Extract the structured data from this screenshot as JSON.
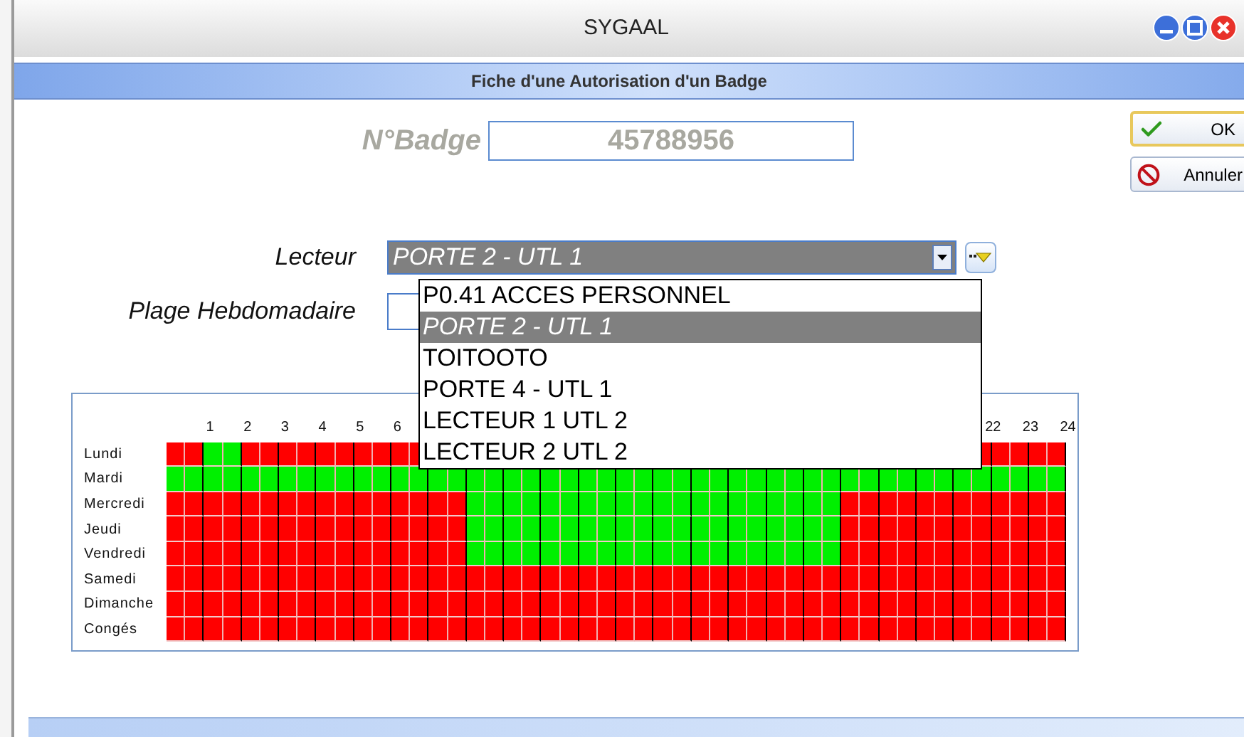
{
  "window": {
    "title": "SYGAAL"
  },
  "header": {
    "title": "Fiche d'une Autorisation d'un Badge"
  },
  "badge": {
    "label": "N°Badge",
    "value": "45788956"
  },
  "buttons": [
    {
      "kind": "ok",
      "label": "OK"
    },
    {
      "kind": "cancel",
      "label": "Annuler"
    }
  ],
  "lecteur": {
    "label": "Lecteur",
    "value": "PORTE 2 - UTL 1",
    "expanded": true,
    "options": [
      {
        "label": "P0.41 ACCES PERSONNEL",
        "selected": false
      },
      {
        "label": "PORTE 2 - UTL 1",
        "selected": true
      },
      {
        "label": "TOITOOTO",
        "selected": false
      },
      {
        "label": "PORTE 4 - UTL 1",
        "selected": false
      },
      {
        "label": "LECTEUR 1 UTL 2",
        "selected": false
      },
      {
        "label": "LECTEUR 2 UTL 2",
        "selected": false
      }
    ]
  },
  "plage": {
    "label": "Plage Hebdomadaire"
  },
  "hour_labels_start": [
    "1",
    "2",
    "3",
    "4",
    "5",
    "6"
  ],
  "hour_labels_end": [
    "22",
    "23",
    "24"
  ],
  "days": [
    {
      "label": "Lundi",
      "slots_start": [
        false,
        false,
        true,
        true,
        false,
        false,
        false,
        false,
        false,
        false,
        false,
        false,
        false,
        false
      ],
      "slots_end": [
        false,
        false,
        false,
        false,
        false
      ]
    },
    {
      "label": "Mardi",
      "slots": [
        true,
        true,
        true,
        true,
        true,
        true,
        true,
        true,
        true,
        true,
        true,
        true,
        true,
        true,
        true,
        true,
        true,
        true,
        true,
        true,
        true,
        true,
        true,
        true,
        true,
        true,
        true,
        true,
        true,
        true,
        true,
        true,
        true,
        true,
        true,
        true,
        true,
        true,
        true,
        true,
        true,
        true,
        true,
        true,
        true,
        true,
        true,
        true
      ]
    },
    {
      "label": "Mercredi",
      "slots": [
        false,
        false,
        false,
        false,
        false,
        false,
        false,
        false,
        false,
        false,
        false,
        false,
        false,
        false,
        false,
        false,
        true,
        true,
        true,
        true,
        true,
        true,
        true,
        true,
        true,
        true,
        true,
        true,
        true,
        true,
        true,
        true,
        true,
        true,
        true,
        true,
        false,
        false,
        false,
        false,
        false,
        false,
        false,
        false,
        false,
        false,
        false,
        false
      ]
    },
    {
      "label": "Jeudi",
      "slots": [
        false,
        false,
        false,
        false,
        false,
        false,
        false,
        false,
        false,
        false,
        false,
        false,
        false,
        false,
        false,
        false,
        true,
        true,
        true,
        true,
        true,
        true,
        true,
        true,
        true,
        true,
        true,
        true,
        true,
        true,
        true,
        true,
        true,
        true,
        true,
        true,
        false,
        false,
        false,
        false,
        false,
        false,
        false,
        false,
        false,
        false,
        false,
        false
      ]
    },
    {
      "label": "Vendredi",
      "slots": [
        false,
        false,
        false,
        false,
        false,
        false,
        false,
        false,
        false,
        false,
        false,
        false,
        false,
        false,
        false,
        false,
        true,
        true,
        true,
        true,
        true,
        true,
        true,
        true,
        true,
        true,
        true,
        true,
        true,
        true,
        true,
        true,
        true,
        true,
        true,
        true,
        false,
        false,
        false,
        false,
        false,
        false,
        false,
        false,
        false,
        false,
        false,
        false
      ]
    },
    {
      "label": "Samedi",
      "slots": [
        false,
        false,
        false,
        false,
        false,
        false,
        false,
        false,
        false,
        false,
        false,
        false,
        false,
        false,
        false,
        false,
        false,
        false,
        false,
        false,
        false,
        false,
        false,
        false,
        false,
        false,
        false,
        false,
        false,
        false,
        false,
        false,
        false,
        false,
        false,
        false,
        false,
        false,
        false,
        false,
        false,
        false,
        false,
        false,
        false,
        false,
        false,
        false
      ]
    },
    {
      "label": "Dimanche",
      "slots": [
        false,
        false,
        false,
        false,
        false,
        false,
        false,
        false,
        false,
        false,
        false,
        false,
        false,
        false,
        false,
        false,
        false,
        false,
        false,
        false,
        false,
        false,
        false,
        false,
        false,
        false,
        false,
        false,
        false,
        false,
        false,
        false,
        false,
        false,
        false,
        false,
        false,
        false,
        false,
        false,
        false,
        false,
        false,
        false,
        false,
        false,
        false,
        false
      ]
    },
    {
      "label": "Congés",
      "slots": [
        false,
        false,
        false,
        false,
        false,
        false,
        false,
        false,
        false,
        false,
        false,
        false,
        false,
        false,
        false,
        false,
        false,
        false,
        false,
        false,
        false,
        false,
        false,
        false,
        false,
        false,
        false,
        false,
        false,
        false,
        false,
        false,
        false,
        false,
        false,
        false,
        false,
        false,
        false,
        false,
        false,
        false,
        false,
        false,
        false,
        false,
        false,
        false
      ]
    }
  ]
}
